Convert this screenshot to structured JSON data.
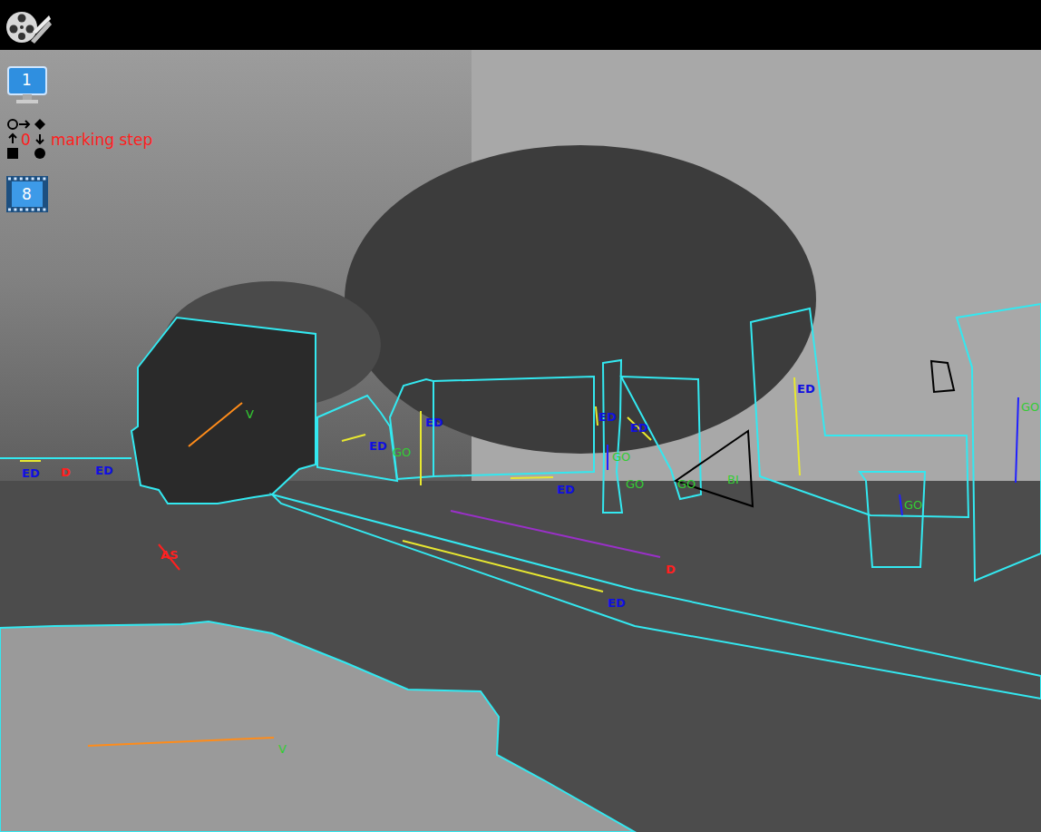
{
  "app": {
    "monitor_number": "1",
    "step_count": "0",
    "step_label": "marking step",
    "frame_number": "8"
  },
  "annotations": [
    {
      "label": "V",
      "label_color": "#33cc33",
      "line_color": "#ff8c1a"
    },
    {
      "label": "V",
      "label_color": "#33cc33",
      "line_color": "#ff8c1a"
    },
    {
      "label": "ED",
      "label_color": "#1010e0",
      "line_color": "#e8e830"
    },
    {
      "label": "D",
      "label_color": "#ff2020"
    },
    {
      "label": "ED",
      "label_color": "#1010e0"
    },
    {
      "label": "AS",
      "label_color": "#ff2020",
      "line_color": "#ff2020"
    },
    {
      "label": "ED",
      "label_color": "#1010e0",
      "line_color": "#e8e830"
    },
    {
      "label": "GO",
      "label_color": "#33cc33"
    },
    {
      "label": "ED",
      "label_color": "#1010e0",
      "line_color": "#e8e830"
    },
    {
      "label": "ED",
      "label_color": "#1010e0",
      "line_color": "#e8e830"
    },
    {
      "label": "ED",
      "label_color": "#1010e0",
      "line_color": "#e8e830"
    },
    {
      "label": "GO",
      "label_color": "#33cc33",
      "line_color": "#2020ff"
    },
    {
      "label": "GO",
      "label_color": "#33cc33"
    },
    {
      "label": "ED",
      "label_color": "#1010e0",
      "line_color": "#e8e830"
    },
    {
      "label": "GO",
      "label_color": "#33cc33"
    },
    {
      "label": "BI",
      "label_color": "#33cc33"
    },
    {
      "label": "D",
      "label_color": "#ff2020",
      "line_color": "#9a30c8"
    },
    {
      "label": "ED",
      "label_color": "#1010e0",
      "line_color": "#e8e830"
    },
    {
      "label": "ED",
      "label_color": "#1010e0",
      "line_color": "#e8e830"
    },
    {
      "label": "GO",
      "label_color": "#33cc33",
      "line_color": "#2020ff"
    },
    {
      "label": "GO",
      "label_color": "#33cc33",
      "line_color": "#2020ff"
    }
  ]
}
